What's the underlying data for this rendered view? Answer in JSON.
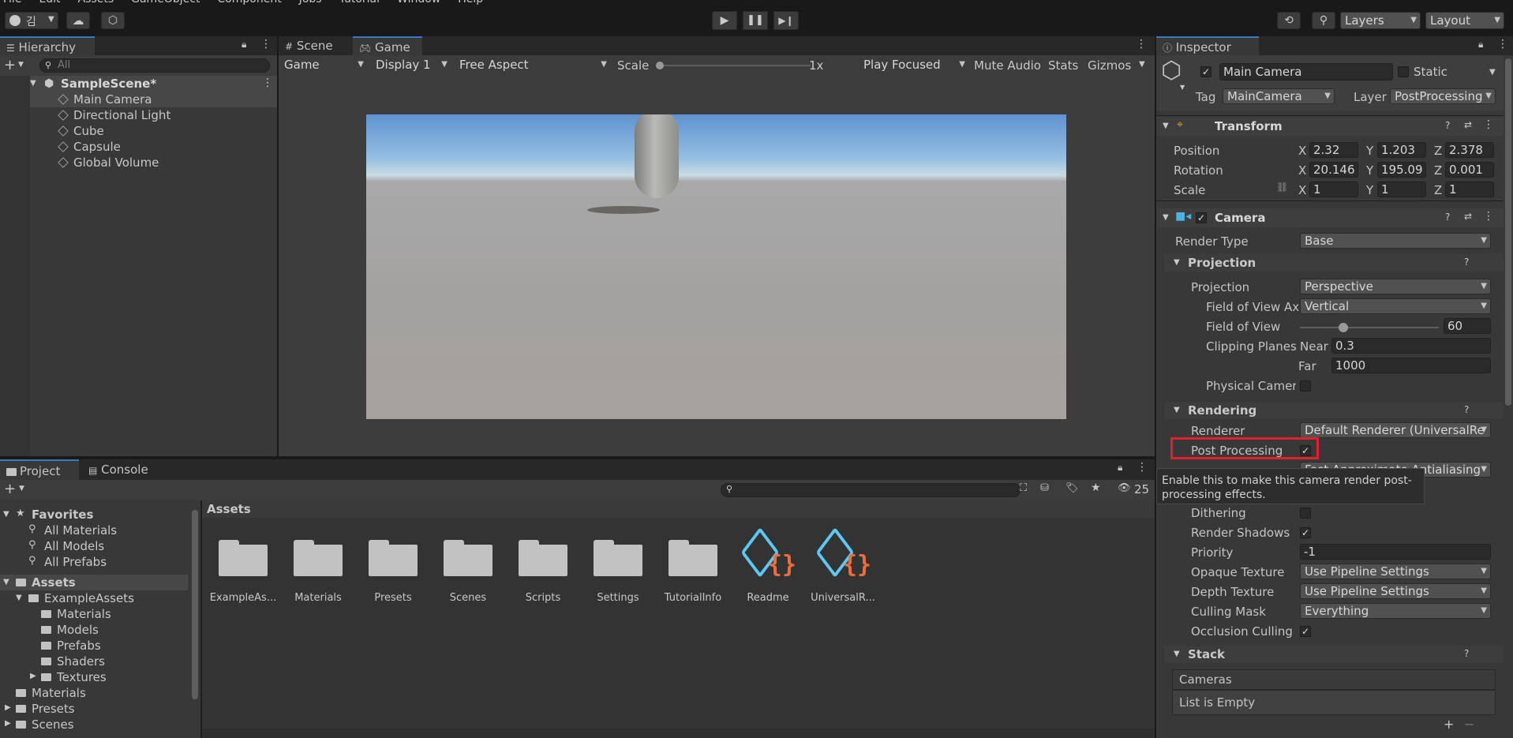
{
  "menu": [
    "File",
    "Edit",
    "Assets",
    "GameObject",
    "Component",
    "Jobs",
    "Tutorial",
    "Window",
    "Help"
  ],
  "toolbar": {
    "account_initial": "김",
    "layers": "Layers",
    "layout": "Layout"
  },
  "hierarchy": {
    "tab": "Hierarchy",
    "search_placeholder": "All",
    "scene": "SampleScene*",
    "items": [
      "Main Camera",
      "Directional Light",
      "Cube",
      "Capsule",
      "Global Volume"
    ]
  },
  "game_view": {
    "tabs": [
      "Scene",
      "Game"
    ],
    "toolbar": {
      "mode": "Game",
      "display": "Display 1",
      "aspect": "Free Aspect",
      "scale_label": "Scale",
      "scale_value": "1x",
      "play_focus": "Play Focused",
      "mute": "Mute Audio",
      "stats": "Stats",
      "gizmos": "Gizmos"
    }
  },
  "project": {
    "tabs": [
      "Project",
      "Console"
    ],
    "badge": "25",
    "favorites": {
      "label": "Favorites",
      "items": [
        "All Materials",
        "All Models",
        "All Prefabs"
      ]
    },
    "tree": {
      "root": "Assets",
      "example": "ExampleAssets",
      "example_children": [
        "Materials",
        "Models",
        "Prefabs",
        "Shaders",
        "Textures"
      ],
      "others": [
        "Materials",
        "Presets",
        "Scenes"
      ]
    },
    "breadcrumb": "Assets",
    "assets": [
      {
        "name": "ExampleAs...",
        "icon": "folder-icon"
      },
      {
        "name": "Materials",
        "icon": "folder-icon"
      },
      {
        "name": "Presets",
        "icon": "folder-icon"
      },
      {
        "name": "Scenes",
        "icon": "folder-icon"
      },
      {
        "name": "Scripts",
        "icon": "folder-icon"
      },
      {
        "name": "Settings",
        "icon": "folder-icon"
      },
      {
        "name": "TutorialInfo",
        "icon": "folder-icon"
      },
      {
        "name": "Readme",
        "icon": "script-asset-icon"
      },
      {
        "name": "UniversalR...",
        "icon": "script-asset-icon"
      }
    ]
  },
  "inspector": {
    "tab": "Inspector",
    "object_name": "Main Camera",
    "static_label": "Static",
    "tag_label": "Tag",
    "tag_value": "MainCamera",
    "layer_label": "Layer",
    "layer_value": "PostProcessing",
    "transform": {
      "title": "Transform",
      "position": {
        "label": "Position",
        "x": "2.32",
        "y": "1.203",
        "z": "2.378"
      },
      "rotation": {
        "label": "Rotation",
        "x": "20.146",
        "y": "195.09",
        "z": "0.001"
      },
      "scale": {
        "label": "Scale",
        "x": "1",
        "y": "1",
        "z": "1"
      }
    },
    "camera": {
      "title": "Camera",
      "render_type_label": "Render Type",
      "render_type": "Base",
      "projection_header": "Projection",
      "projection_label": "Projection",
      "projection_value": "Perspective",
      "fov_axis_label": "Field of View Ax",
      "fov_axis_value": "Vertical",
      "fov_label": "Field of View",
      "fov_value": "60",
      "fov_slider_fraction": 0.3,
      "clip_label": "Clipping Planes",
      "near_label": "Near",
      "near_value": "0.3",
      "far_label": "Far",
      "far_value": "1000",
      "physical_label": "Physical Camera",
      "rendering_header": "Rendering",
      "renderer_label": "Renderer",
      "renderer_value": "Default Renderer (UniversalRe",
      "post_label": "Post Processing",
      "antialias_value": "Fast Approximate Antialiasing",
      "tooltip": "Enable this to make this camera render post-processing effects.",
      "dithering_label": "Dithering",
      "shadows_label": "Render Shadows",
      "priority_label": "Priority",
      "priority_value": "-1",
      "opaque_label": "Opaque Texture",
      "opaque_value": "Use Pipeline Settings",
      "depth_label": "Depth Texture",
      "depth_value": "Use Pipeline Settings",
      "culling_label": "Culling Mask",
      "culling_value": "Everything",
      "occlusion_label": "Occlusion Culling",
      "stack_header": "Stack",
      "cameras_label": "Cameras",
      "list_empty": "List is Empty"
    }
  },
  "colors": {
    "accent": "#3a79bb",
    "highlight_box": "#e0202a",
    "script_icon_blue": "#5bc8f5",
    "script_icon_orange": "#f26b3a"
  }
}
